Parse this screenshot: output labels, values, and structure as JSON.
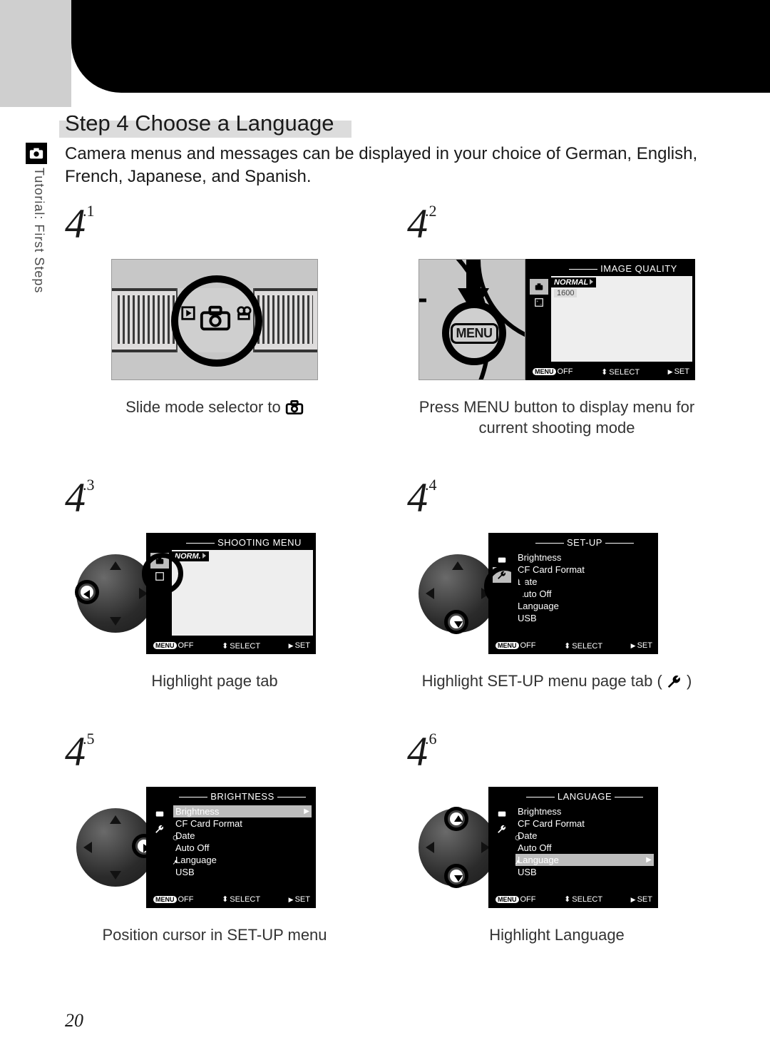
{
  "sidebar": {
    "label": "Tutorial: First Steps"
  },
  "heading": "Step 4 Choose a Language",
  "body": "Camera menus and messages can be displayed in your choice of German, English, French, Japanese, and Spanish.",
  "steps": {
    "s41": {
      "num": "4",
      "sub": ".1",
      "caption_pre": "Slide mode selector to "
    },
    "s42": {
      "num": "4",
      "sub": ".2",
      "caption": "Press MENU button to display menu for current shooting mode",
      "menu_label": "MENU",
      "lcd_title": "IMAGE QUALITY",
      "norm": "NORMAL",
      "res": "1600"
    },
    "s43": {
      "num": "4",
      "sub": ".3",
      "caption": "Highlight page tab",
      "lcd_title": "SHOOTING MENU",
      "norm": "NORM."
    },
    "s44": {
      "num": "4",
      "sub": ".4",
      "caption_pre": "Highlight SET-UP menu page tab ( ",
      "caption_post": " )",
      "lcd_title": "SET-UP",
      "menu": [
        "Brightness",
        "CF Card Format",
        "Date",
        "Auto Off",
        "Language",
        "USB"
      ]
    },
    "s45": {
      "num": "4",
      "sub": ".5",
      "caption": "Position cursor in SET-UP menu",
      "lcd_title": "BRIGHTNESS",
      "menu": [
        "Brightness",
        "CF Card Format",
        "Date",
        "Auto Off",
        "Language",
        "USB"
      ],
      "hi_index": 0
    },
    "s46": {
      "num": "4",
      "sub": ".6",
      "caption": "Highlight Language",
      "lcd_title": "LANGUAGE",
      "menu": [
        "Brightness",
        "CF Card Format",
        "Date",
        "Auto Off",
        "Language",
        "USB"
      ],
      "hi_index": 4
    }
  },
  "footer": {
    "off": "OFF",
    "select": "SELECT",
    "set": "SET",
    "menu": "MENU"
  },
  "page": "20"
}
